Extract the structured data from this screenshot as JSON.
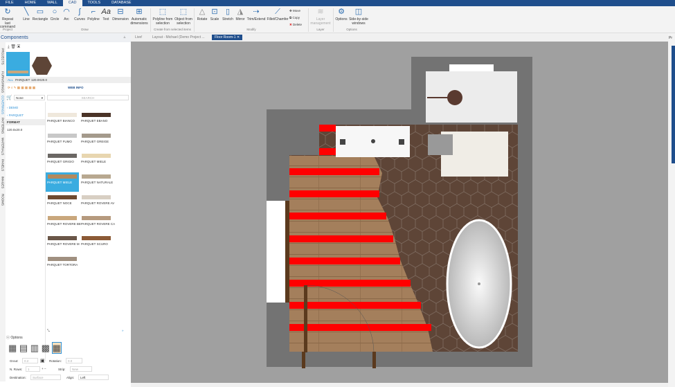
{
  "menu": [
    "FILE",
    "HOME",
    "WALL",
    "CAD",
    "TOOLS",
    "DATABASE"
  ],
  "ribbon": {
    "project": [
      {
        "label": "Repeat last command",
        "icon": "repeat-icon"
      }
    ],
    "draw": [
      {
        "label": "Line",
        "icon": "line-icon"
      },
      {
        "label": "Rectangle",
        "icon": "rectangle-icon"
      },
      {
        "label": "Circle",
        "icon": "circle-icon"
      },
      {
        "label": "Arc",
        "icon": "arc-icon"
      },
      {
        "label": "Curves",
        "icon": "curves-icon"
      },
      {
        "label": "Polyline",
        "icon": "polyline-icon"
      },
      {
        "label": "Text",
        "icon": "text-icon"
      },
      {
        "label": "Dimension",
        "icon": "dimension-icon"
      },
      {
        "label": "Automatic dimensions",
        "icon": "auto-dimension-icon"
      }
    ],
    "create": [
      {
        "label": "Polyline from selection"
      },
      {
        "label": "Object from selection"
      }
    ],
    "modify": [
      {
        "label": "Rotate"
      },
      {
        "label": "Scale"
      },
      {
        "label": "Stretch"
      },
      {
        "label": "Mirror"
      },
      {
        "label": "Trim/Extend"
      },
      {
        "label": "Fillet/Chamfer"
      }
    ],
    "modify_small": [
      "Move",
      "Copy",
      "Delete"
    ],
    "layer": "Layer management",
    "options": [
      {
        "label": "Options"
      },
      {
        "label": "Side-by-side windows"
      }
    ],
    "groups": [
      "Project",
      "Draw",
      "Create from selected items",
      "Modify",
      "Layer",
      "Options"
    ]
  },
  "panel": {
    "title": "Components",
    "vtabs": [
      "PROJECTS",
      "FURNISHINGS",
      "COVERINGS",
      "PATTERNS",
      "MATERIALS",
      "PANELS",
      "IMAGES",
      "ROOMS"
    ],
    "crumbs": [
      "ALL",
      "PARQUET",
      "120.0X20.0"
    ],
    "web_info": "WEB INFO",
    "filter": "None",
    "search_placeholder": "SEARCH",
    "tree": [
      "DEMO",
      "PARQUET",
      "FORMAT",
      "120.0x20.0"
    ],
    "items": [
      "PARQUET BIANCO",
      "PARQUET EBANO",
      "PARQUET FUMO",
      "PARQUET GREIGE",
      "PARQUET GRIGIO",
      "PARQUET MIELE",
      "PARQUET MIELE",
      "PARQUET NATURALE",
      "PARQUET NOCE",
      "PARQUET ROVERE AV",
      "PARQUET ROVERE BE",
      "PARQUET ROVERE CA",
      "PARQUET ROVERE M",
      "PARQUET SCURO",
      "PARQUET TORTORA"
    ],
    "item_colors": [
      "#efe8dc",
      "#4a3327",
      "#c8c8c8",
      "#a49a8c",
      "#6b6764",
      "#e8d6b0",
      "#b38a5e",
      "#b8a890",
      "#6e4a30",
      "#d8cfc3",
      "#c9a77c",
      "#b69a7e",
      "#6a5648",
      "#8c5a36",
      "#a09080"
    ],
    "options": {
      "title": "Options",
      "grout_label": "Grout:",
      "grout": "0.2",
      "rotation_label": "Rotation:",
      "rotation": "0.0",
      "rows_label": "N. Rows:",
      "rows": "1",
      "strip_label": "Strip:",
      "strip": "New",
      "destination_label": "Destination:",
      "destination": "Surface",
      "align_label": "Align:",
      "align": "Left"
    }
  },
  "doc_tabs": [
    "Live!",
    "Layout - Michael (Demo Project ...",
    "Floor Room-1"
  ],
  "right_panel": "Pr"
}
